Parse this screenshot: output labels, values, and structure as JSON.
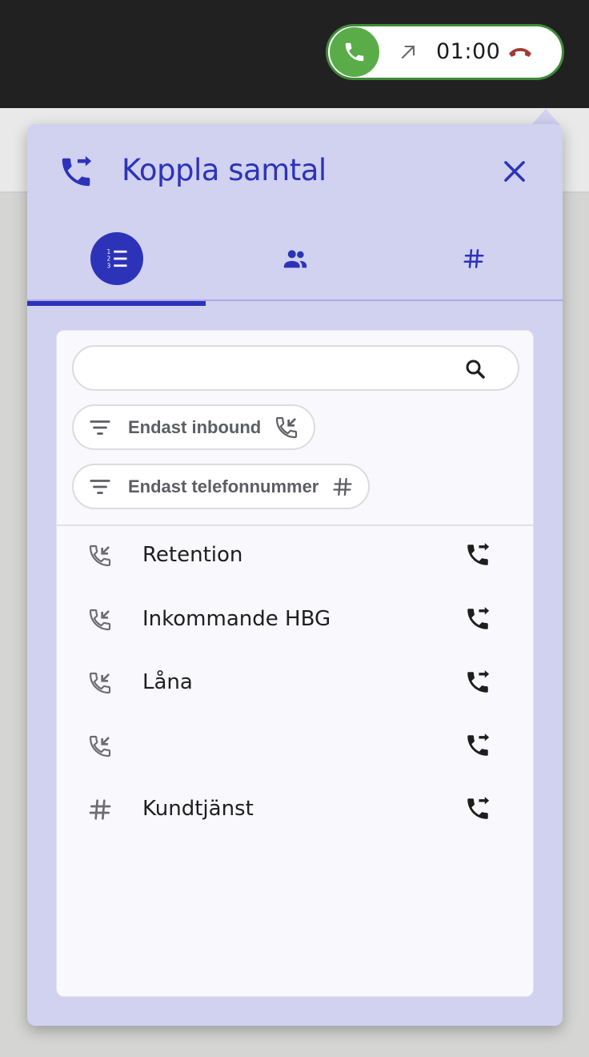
{
  "call_widget": {
    "timer": "01:00",
    "colors": {
      "accept": "#5aac48",
      "hangup": "#a33b34",
      "border": "#3f8a3a"
    }
  },
  "panel": {
    "title": "Koppla samtal",
    "title_icon": "phone-forward-icon",
    "close_icon": "close-icon",
    "accent": "#2d33b8",
    "tabs": [
      {
        "name": "list",
        "icon": "numbered-list-icon",
        "active": true
      },
      {
        "name": "contacts",
        "icon": "people-icon",
        "active": false
      },
      {
        "name": "number",
        "icon": "hash-icon",
        "active": false
      }
    ]
  },
  "search": {
    "placeholder": "",
    "value": "",
    "icon": "search-icon"
  },
  "filters": [
    {
      "label": "Endast inbound",
      "icon": "filter-icon",
      "trailing_icon": "phone-incoming-icon"
    },
    {
      "label": "Endast telefonnummer",
      "icon": "filter-icon",
      "trailing_icon": "hash-icon"
    }
  ],
  "items": [
    {
      "label": "Retention",
      "type_icon": "phone-incoming-icon",
      "action_icon": "phone-forward-icon"
    },
    {
      "label": "Inkommande HBG",
      "type_icon": "phone-incoming-icon",
      "action_icon": "phone-forward-icon"
    },
    {
      "label": "Låna",
      "type_icon": "phone-incoming-icon",
      "action_icon": "phone-forward-icon"
    },
    {
      "label": "",
      "type_icon": "phone-incoming-icon",
      "action_icon": "phone-forward-icon"
    },
    {
      "label": "Kundtjänst",
      "type_icon": "hash-icon",
      "action_icon": "phone-forward-icon"
    }
  ]
}
